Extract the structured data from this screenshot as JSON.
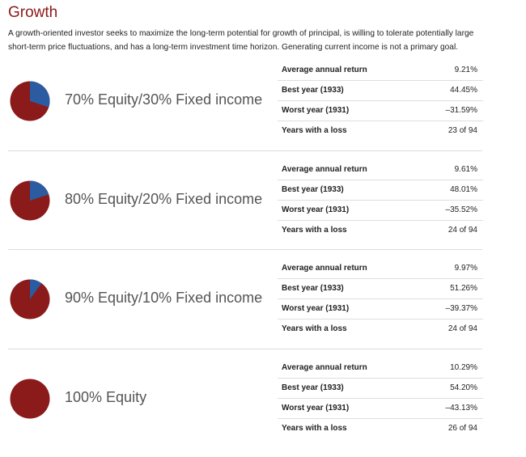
{
  "title": "Growth",
  "description": "A growth-oriented investor seeks to maximize the long-term potential for growth of principal, is willing to tolerate potentially large short-term price fluctuations, and has a long-term investment time horizon. Generating current income is not a primary goal.",
  "colors": {
    "equity": "#8b1a1a",
    "fixed_income": "#2b5ba0",
    "title": "#8b1a1a"
  },
  "portfolios": [
    {
      "allocation_label": "70% Equity/30% Fixed income",
      "equity_fraction": 0.7,
      "stats": [
        {
          "label": "Average annual return",
          "value": "9.21%"
        },
        {
          "label": "Best year (1933)",
          "value": "44.45%"
        },
        {
          "label": "Worst year (1931)",
          "value": "–31.59%"
        },
        {
          "label": "Years with a loss",
          "value": "23 of 94"
        }
      ]
    },
    {
      "allocation_label": "80% Equity/20% Fixed income",
      "equity_fraction": 0.8,
      "stats": [
        {
          "label": "Average annual return",
          "value": "9.61%"
        },
        {
          "label": "Best year (1933)",
          "value": "48.01%"
        },
        {
          "label": "Worst year (1931)",
          "value": "–35.52%"
        },
        {
          "label": "Years with a loss",
          "value": "24 of 94"
        }
      ]
    },
    {
      "allocation_label": "90% Equity/10% Fixed income",
      "equity_fraction": 0.9,
      "stats": [
        {
          "label": "Average annual return",
          "value": "9.97%"
        },
        {
          "label": "Best year (1933)",
          "value": "51.26%"
        },
        {
          "label": "Worst year (1931)",
          "value": "–39.37%"
        },
        {
          "label": "Years with a loss",
          "value": "24 of 94"
        }
      ]
    },
    {
      "allocation_label": "100% Equity",
      "equity_fraction": 1.0,
      "stats": [
        {
          "label": "Average annual return",
          "value": "10.29%"
        },
        {
          "label": "Best year (1933)",
          "value": "54.20%"
        },
        {
          "label": "Worst year (1931)",
          "value": "–43.13%"
        },
        {
          "label": "Years with a loss",
          "value": "26 of 94"
        }
      ]
    }
  ]
}
